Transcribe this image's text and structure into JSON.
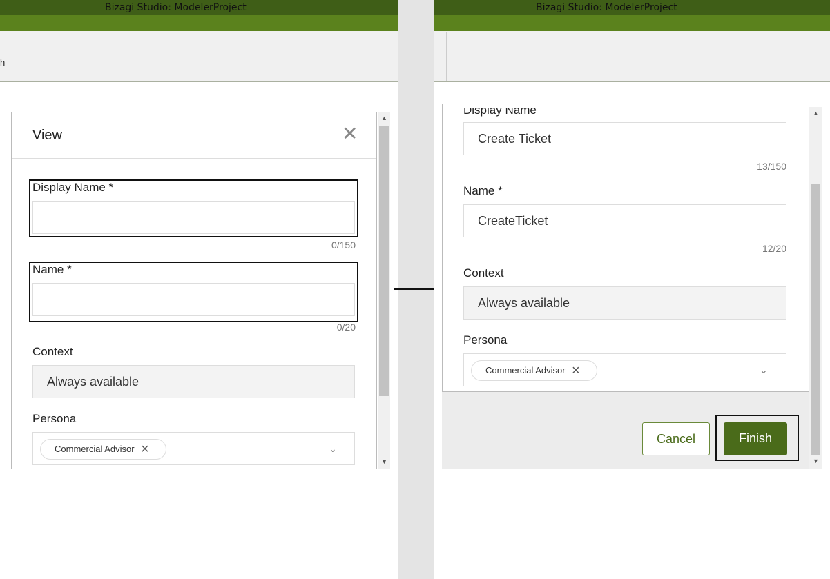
{
  "window_title": "Bizagi Studio: ModelerProject",
  "toolbar_fragment": "h",
  "before": {
    "dialog_title": "View",
    "display_name": {
      "label": "Display Name *",
      "value": "",
      "count": "0/150"
    },
    "name": {
      "label": "Name *",
      "value": "",
      "count": "0/20"
    },
    "context": {
      "label": "Context",
      "value": "Always available"
    },
    "persona": {
      "label": "Persona",
      "chip": "Commercial Advisor"
    }
  },
  "after": {
    "display_name": {
      "label": "Display Name",
      "value": "Create Ticket",
      "count": "13/150"
    },
    "name": {
      "label": "Name *",
      "value": "CreateTicket",
      "count": "12/20"
    },
    "context": {
      "label": "Context",
      "value": "Always available"
    },
    "persona": {
      "label": "Persona",
      "chip": "Commercial Advisor"
    },
    "cancel_label": "Cancel",
    "finish_label": "Finish"
  },
  "colors": {
    "title_bar": "#3f5e17",
    "ribbon": "#5b821d",
    "finish_button": "#4a6b1a"
  }
}
